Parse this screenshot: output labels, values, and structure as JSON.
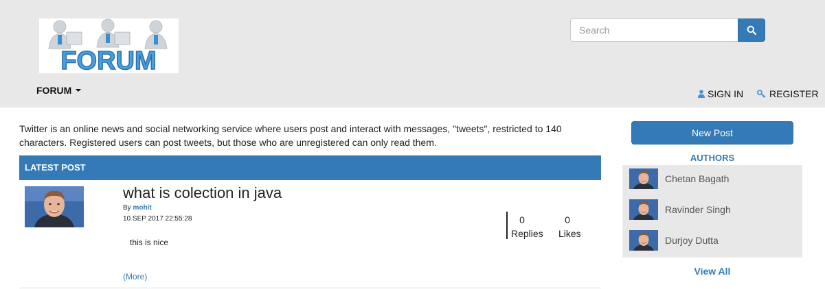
{
  "header": {
    "logo_text": "FORUM",
    "search": {
      "placeholder": "Search",
      "value": ""
    },
    "menu_label": "FORUM",
    "sign_in_label": "SIGN IN",
    "register_label": "REGISTER"
  },
  "intro_text": "Twitter is an online news and social networking service where users post and interact with messages, \"tweets\", restricted to 140 characters. Registered users can post tweets, but those who are unregistered can only read them.",
  "latest": {
    "heading": "LATEST POST",
    "post": {
      "title": "what is colection in java",
      "by_prefix": "By",
      "author": "mohit",
      "date": "10 SEP 2017 22:55:28",
      "body": "this is nice",
      "more_label": "(More)",
      "replies_count": "0",
      "replies_label": "Replies",
      "likes_count": "0",
      "likes_label": "Likes"
    }
  },
  "sidebar": {
    "new_post_label": "New Post",
    "authors_title": "AUTHORS",
    "authors": [
      {
        "name": "Chetan Bagath"
      },
      {
        "name": "Ravinder Singh"
      },
      {
        "name": "Durjoy Dutta"
      }
    ],
    "view_all_label": "View All"
  },
  "colors": {
    "accent": "#337ab7",
    "header_bg": "#e8e8e8"
  },
  "icons": [
    "search-icon",
    "user-icon",
    "key-icon",
    "caret-down-icon"
  ]
}
